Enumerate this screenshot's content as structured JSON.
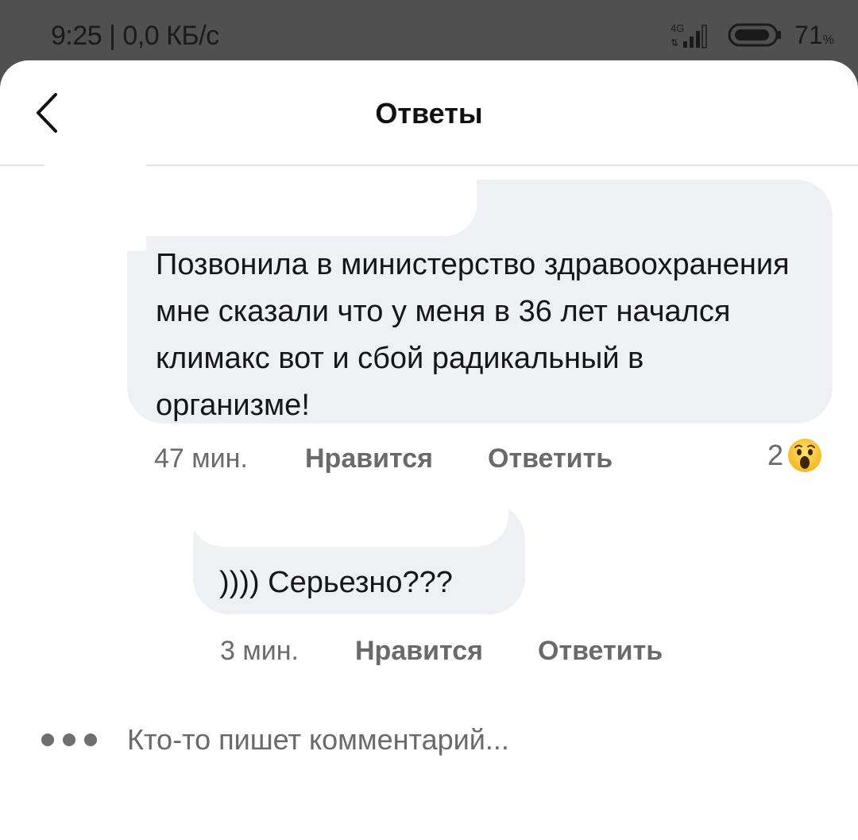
{
  "status_bar": {
    "time_network": "9:25 | 0,0 КБ/с",
    "network_type": "4G",
    "battery_percent": "71",
    "battery_unit": "%"
  },
  "header": {
    "title": "Ответы",
    "back_icon": "chevron-left-icon"
  },
  "comments": [
    {
      "text": "Позвонила в министерство здравоохранения мне сказали что у меня в 36 лет начался климакс вот и сбой радикальный в организме!",
      "time": "47 мин.",
      "like_label": "Нравится",
      "reply_label": "Ответить",
      "reaction_count": "2",
      "reaction_icon": "wow-emoji-icon"
    },
    {
      "text": ")))) Серьезно???",
      "time": "3 мин.",
      "like_label": "Нравится",
      "reply_label": "Ответить"
    }
  ],
  "typing_indicator": {
    "text": "Кто-то пишет комментарий..."
  },
  "colors": {
    "bubble": "#eff0f4",
    "meta_text": "#6a6a6a",
    "status_bar_bg": "#505050"
  }
}
